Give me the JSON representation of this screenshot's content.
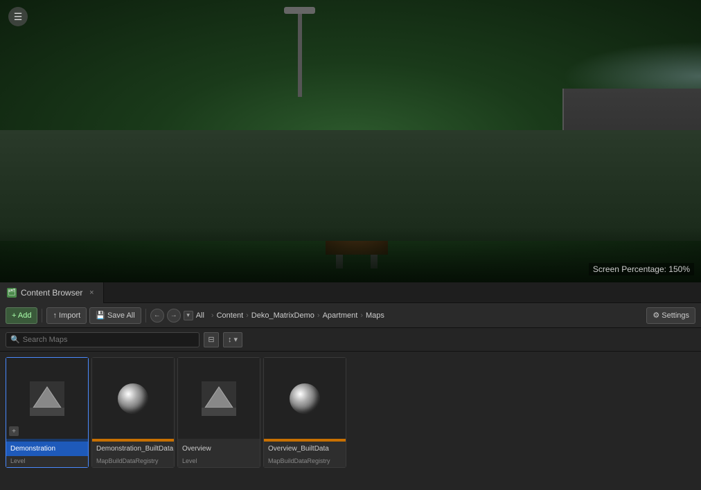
{
  "viewport": {
    "screen_percentage_label": "Screen Percentage: 150%"
  },
  "menu_button": "☰",
  "tab_bar": {
    "tab_label": "Content Browser",
    "tab_close": "×"
  },
  "toolbar": {
    "add_label": "+ Add",
    "import_label": "↑ Import",
    "save_all_label": "💾 Save All",
    "nav_back": "←",
    "nav_forward": "→",
    "all_label": "All",
    "breadcrumb": [
      {
        "label": "Content",
        "sep": "›"
      },
      {
        "label": "Deko_MatrixDemo",
        "sep": "›"
      },
      {
        "label": "Apartment",
        "sep": "›"
      },
      {
        "label": "Maps",
        "sep": ""
      }
    ],
    "settings_label": "⚙ Settings"
  },
  "search_bar": {
    "placeholder": "Search Maps",
    "view_icon": "⊟",
    "sort_icon": "↕",
    "sort_chevron": "▾"
  },
  "assets": [
    {
      "id": "demonstration",
      "name": "Demonstration",
      "type": "Level",
      "icon_type": "level",
      "selected": true,
      "bar_color": "transparent",
      "has_add_icon": true
    },
    {
      "id": "demonstration-builtdata",
      "name": "Demonstration_BuiltData",
      "type": "MapBuildDataRegistry",
      "icon_type": "mapbuild",
      "selected": false,
      "bar_color": "orange",
      "has_add_icon": false
    },
    {
      "id": "overview",
      "name": "Overview",
      "type": "Level",
      "icon_type": "level",
      "selected": false,
      "bar_color": "transparent",
      "has_add_icon": false
    },
    {
      "id": "overview-builtdata",
      "name": "Overview_BuiltData",
      "type": "MapBuildDataRegistry",
      "icon_type": "mapbuild",
      "selected": false,
      "bar_color": "orange",
      "has_add_icon": false
    }
  ]
}
